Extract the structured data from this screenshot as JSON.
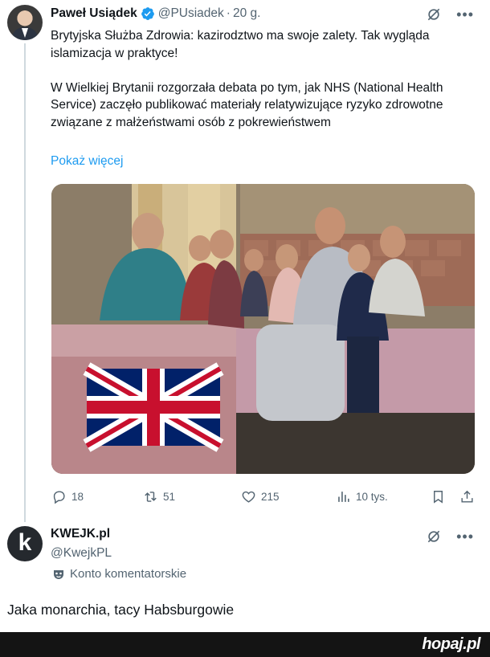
{
  "tweet": {
    "author_name": "Paweł Usiądek",
    "author_handle": "@PUsiadek",
    "separator": "·",
    "time": "20 g.",
    "paragraph1": "Brytyjska Służba Zdrowia: kazirodztwo ma swoje zalety. Tak wygląda islamizacja w praktyce!",
    "paragraph2": "W Wielkiej Brytanii rozgorzała debata po tym, jak NHS (National Health Service) zaczęło publikować materiały relatywizujące ryzyko zdrowotne związane z małżeństwami osób z pokrewieństwem",
    "show_more": "Pokaż więcej",
    "stats": {
      "replies": "18",
      "reposts": "51",
      "likes": "215",
      "views": "10 tys."
    }
  },
  "reply": {
    "avatar_letter": "k",
    "author_name": "KWEJK.pl",
    "author_handle": "@KwejkPL",
    "badge_label": "Konto komentatorskie"
  },
  "caption": "Jaka monarchia, tacy Habsburgowie",
  "footer": {
    "brand": "hopaj.pl"
  },
  "colors": {
    "accent": "#1d9bf0",
    "secondary_text": "#536471",
    "footer_bg": "#141414"
  },
  "icons": [
    "verified-badge-icon",
    "grok-icon",
    "more-icon",
    "reply-icon",
    "repost-icon",
    "like-icon",
    "views-icon",
    "bookmark-icon",
    "share-icon",
    "mask-icon"
  ]
}
